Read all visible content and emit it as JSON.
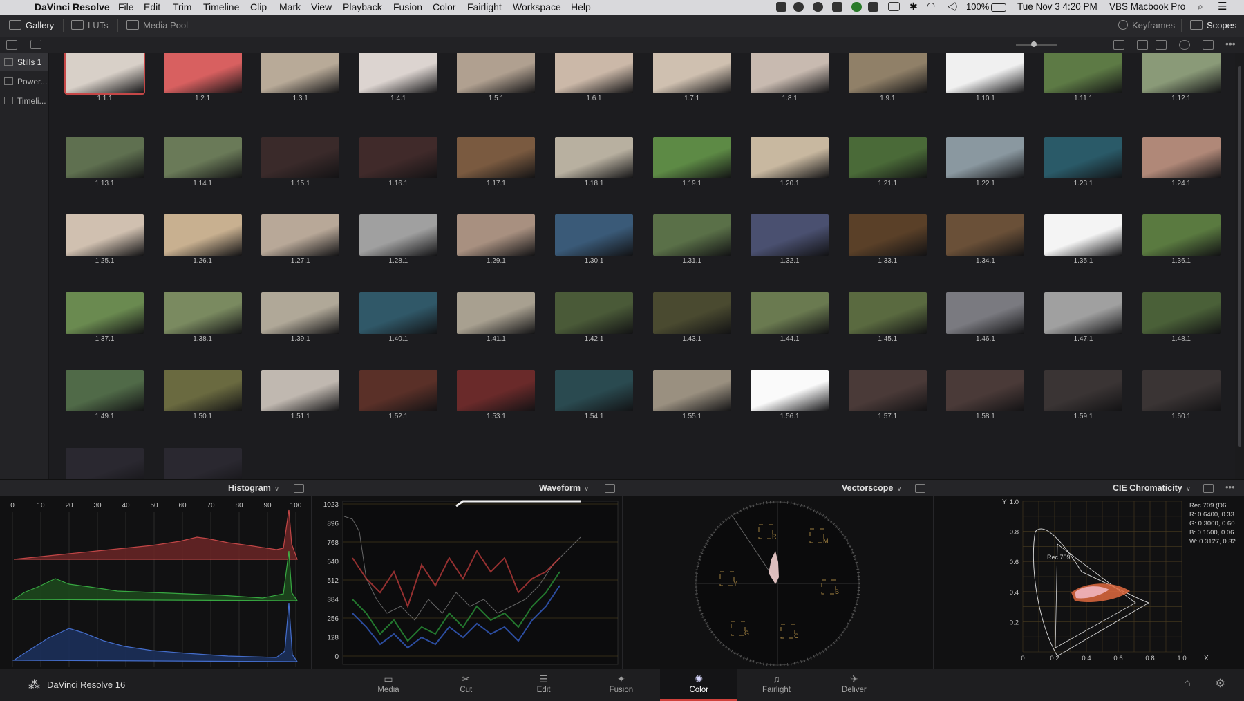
{
  "menubar": {
    "app_name": "DaVinci Resolve",
    "items": [
      "File",
      "Edit",
      "Trim",
      "Timeline",
      "Clip",
      "Mark",
      "View",
      "Playback",
      "Fusion",
      "Color",
      "Fairlight",
      "Workspace",
      "Help"
    ],
    "battery": "100%",
    "datetime": "Tue Nov 3  4:20 PM",
    "computer": "VBS Macbook Pro"
  },
  "toolbar": {
    "gallery": "Gallery",
    "luts": "LUTs",
    "media_pool": "Media Pool",
    "keyframes": "Keyframes",
    "scopes": "Scopes"
  },
  "sidebar": {
    "items": [
      "Stills 1",
      "Power...",
      "Timeli..."
    ]
  },
  "stills": {
    "labels": [
      "1.1.1",
      "1.2.1",
      "1.3.1",
      "1.4.1",
      "1.5.1",
      "1.6.1",
      "1.7.1",
      "1.8.1",
      "1.9.1",
      "1.10.1",
      "1.11.1",
      "1.12.1",
      "1.13.1",
      "1.14.1",
      "1.15.1",
      "1.16.1",
      "1.17.1",
      "1.18.1",
      "1.19.1",
      "1.20.1",
      "1.21.1",
      "1.22.1",
      "1.23.1",
      "1.24.1",
      "1.25.1",
      "1.26.1",
      "1.27.1",
      "1.28.1",
      "1.29.1",
      "1.30.1",
      "1.31.1",
      "1.32.1",
      "1.33.1",
      "1.34.1",
      "1.35.1",
      "1.36.1",
      "1.37.1",
      "1.38.1",
      "1.39.1",
      "1.40.1",
      "1.41.1",
      "1.42.1",
      "1.43.1",
      "1.44.1",
      "1.45.1",
      "1.46.1",
      "1.47.1",
      "1.48.1",
      "1.49.1",
      "1.50.1",
      "1.51.1",
      "1.52.1",
      "1.53.1",
      "1.54.1",
      "1.55.1",
      "1.56.1",
      "1.57.1",
      "1.58.1",
      "1.59.1",
      "1.60.1",
      "",
      ""
    ],
    "colors": [
      "#d8d0c8",
      "#d86060",
      "#b8aa98",
      "#dcd4d0",
      "#b0a090",
      "#cbb8a8",
      "#cfc0b0",
      "#c8bab0",
      "#908068",
      "#f0f0f0",
      "#5d7a45",
      "#8a9a78",
      "#5f7050",
      "#6a7a58",
      "#3a2a2a",
      "#402a2a",
      "#7a5a40",
      "#b8b0a0",
      "#5d8a45",
      "#c8b8a0",
      "#4a6a38",
      "#8a98a0",
      "#2a5a68",
      "#b08878",
      "#d0c0b0",
      "#c8b090",
      "#b8a898",
      "#a0a0a0",
      "#a89080",
      "#3a5a78",
      "#5a7048",
      "#4a5070",
      "#5a4028",
      "#6a5038",
      "#f4f4f4",
      "#5a7a40",
      "#6a8a50",
      "#7a8a60",
      "#b0a898",
      "#305868",
      "#a8a090",
      "#4a5a38",
      "#4a4a30",
      "#6a7a50",
      "#5a6a40",
      "#7a7a80",
      "#a0a0a0",
      "#4a6038",
      "#506a48",
      "#6a6a40",
      "#c0b8b0",
      "#5a3028",
      "#6a2a2a",
      "#2a4a50",
      "#9a9080",
      "#fafafa",
      "#4a3a38",
      "#4a3a38",
      "#3a3434",
      "#3a3434",
      "#2a2830",
      "#2a2830"
    ],
    "selected_index": 0
  },
  "scopes": {
    "histogram": {
      "title": "Histogram",
      "ticks": [
        "0",
        "10",
        "20",
        "30",
        "40",
        "50",
        "60",
        "70",
        "80",
        "90",
        "100"
      ]
    },
    "waveform": {
      "title": "Waveform",
      "ticks": [
        "1023",
        "896",
        "768",
        "640",
        "512",
        "384",
        "256",
        "128",
        "0"
      ]
    },
    "vectorscope": {
      "title": "Vectorscope",
      "targets": [
        "R",
        "M",
        "B",
        "C",
        "G",
        "Y"
      ]
    },
    "cie": {
      "title": "CIE Chromaticity",
      "y_axis": "Y",
      "x_axis": "X",
      "y_ticks": [
        "1.0",
        "0.8",
        "0.6",
        "0.4",
        "0.2"
      ],
      "x_ticks": [
        "0",
        "0.2",
        "0.4",
        "0.6",
        "0.8",
        "1.0"
      ],
      "gamut_label": "Rec.709",
      "legend": [
        "Rec.709 (D6",
        "R: 0.6400, 0.33",
        "G: 0.3000, 0.60",
        "B: 0.1500, 0.06",
        "W: 0.3127, 0.32"
      ]
    }
  },
  "pagebar": {
    "product": "DaVinci Resolve 16",
    "pages": [
      {
        "label": "Media",
        "glyph": "▭"
      },
      {
        "label": "Cut",
        "glyph": "✂"
      },
      {
        "label": "Edit",
        "glyph": "☰"
      },
      {
        "label": "Fusion",
        "glyph": "✦"
      },
      {
        "label": "Color",
        "glyph": "✺"
      },
      {
        "label": "Fairlight",
        "glyph": "♫"
      },
      {
        "label": "Deliver",
        "glyph": "✈"
      }
    ],
    "active_page": "Color"
  },
  "colors": {
    "accent": "#d0413b",
    "selected_outline": "#c54747",
    "panel": "#1c1c1f"
  }
}
